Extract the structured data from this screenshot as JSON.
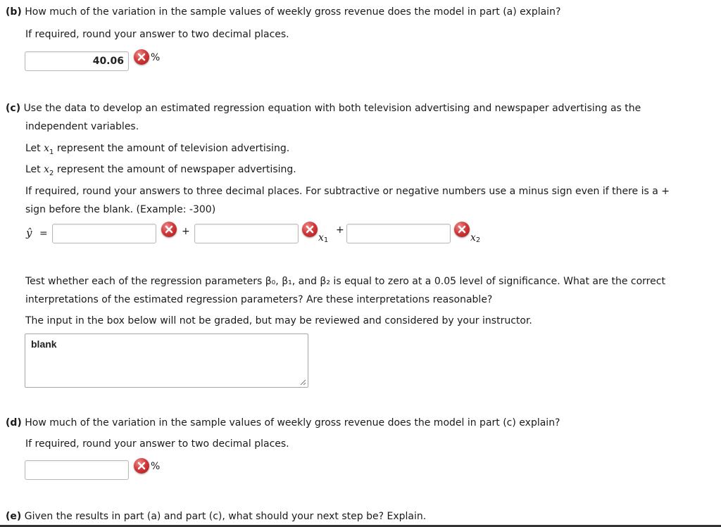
{
  "part_b": {
    "letter": "(b)",
    "question": "How much of the variation in the sample values of weekly gross revenue does the model in part (a) explain?",
    "instruction": "If required, round your answer to two decimal places.",
    "answer_value": "40.06",
    "unit": "%"
  },
  "part_c": {
    "letter": "(c)",
    "question_line1": "Use the data to develop an estimated regression equation with both television advertising and newspaper advertising as the",
    "question_line2": "independent variables.",
    "let_x1_prefix": "Let",
    "let_x1_var": "x",
    "let_x1_sub": "1",
    "let_x1_text": "represent the amount of television advertising.",
    "let_x2_prefix": "Let",
    "let_x2_var": "x",
    "let_x2_sub": "2",
    "let_x2_text": "represent the amount of newspaper advertising.",
    "instruction_line1": "If required, round your answers to three decimal places. For subtractive or negative numbers use a minus sign even if there is a +",
    "instruction_line2": "sign before the blank. (Example: -300)",
    "equation": {
      "yhat": "ŷ",
      "equals": "=",
      "plus1": "+",
      "x1_var": "x",
      "x1_sub": "1",
      "plus2": "+",
      "x2_var": "x",
      "x2_sub": "2",
      "b0_value": "",
      "b1_value": "",
      "b2_value": ""
    },
    "test_line1": "Test whether each of the regression parameters β₀, β₁, and β₂ is equal to zero at a 0.05 level of significance. What are the correct",
    "test_line2": "interpretations of the estimated regression parameters? Are these interpretations reasonable?",
    "note": "The input in the box below will not be graded, but may be reviewed and considered by your instructor.",
    "textarea_value": "blank"
  },
  "part_d": {
    "letter": "(d)",
    "question": "How much of the variation in the sample values of weekly gross revenue does the model in part (c) explain?",
    "instruction": "If required, round your answer to two decimal places.",
    "answer_value": "",
    "unit": "%"
  },
  "part_e": {
    "letter": "(e)",
    "question": "Given the results in part (a) and part (c), what should your next step be? Explain."
  },
  "icons": {
    "incorrect": "incorrect-x-icon",
    "resize": "resize-grip-icon"
  },
  "colors": {
    "incorrect_red": "#d23a3a",
    "input_border": "#b9b9b9"
  }
}
